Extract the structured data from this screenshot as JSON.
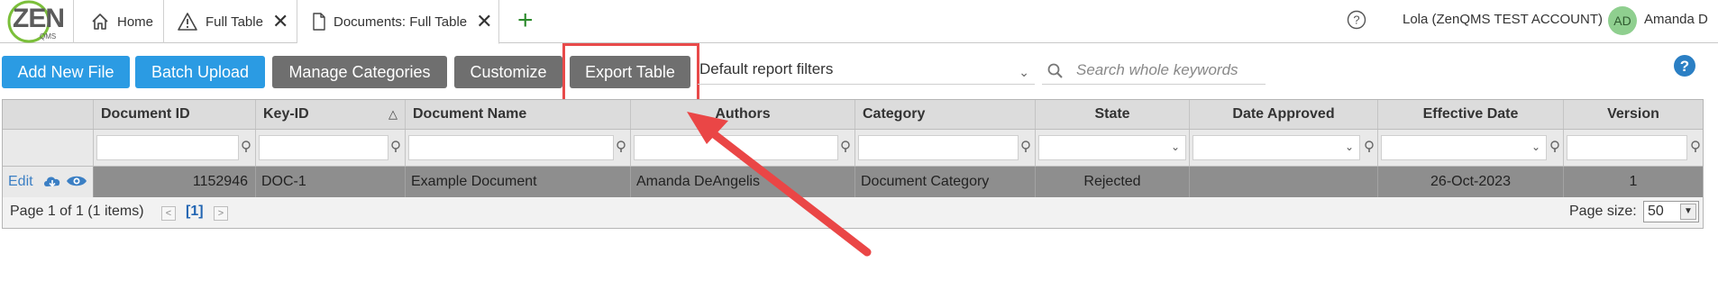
{
  "app": {
    "logo_text": "ZEN",
    "logo_sub": "QMS"
  },
  "tabs": [
    {
      "label": "Home",
      "icon": "home-icon",
      "closable": false
    },
    {
      "label": "Full Table",
      "icon": "warning-icon",
      "closable": true
    },
    {
      "label": "Documents: Full Table",
      "icon": "document-icon",
      "closable": true,
      "active": true
    }
  ],
  "topbar": {
    "add_tab": "+",
    "close_glyph": "✕",
    "help_icon": "question-circle-icon",
    "account": "Lola (ZenQMS TEST ACCOUNT)",
    "avatar_initials": "AD",
    "avatar_color": "#8fcf8f",
    "user_name": "Amanda D"
  },
  "toolbar": {
    "add_new_file": "Add New File",
    "batch_upload": "Batch Upload",
    "manage_categories": "Manage Categories",
    "customize": "Customize",
    "export_table": "Export Table",
    "report_filter": "Default report filters",
    "search_placeholder": "Search whole keywords",
    "primary_color": "#2b9be3",
    "secondary_color": "#6f6f6f",
    "highlight_color": "#e84a4a"
  },
  "grid": {
    "columns": [
      "",
      "Document ID",
      "Key-ID",
      "Document Name",
      "Authors",
      "Category",
      "State",
      "Date Approved",
      "Effective Date",
      "Version"
    ],
    "sort_indicator": "△",
    "rows": [
      {
        "edit": "Edit",
        "document_id": "1152946",
        "key_id": "DOC-1",
        "document_name": "Example Document",
        "authors": "Amanda DeAngelis",
        "category": "Document Category",
        "state": "Rejected",
        "date_approved": "",
        "effective_date": "26-Oct-2023",
        "version": "1"
      }
    ],
    "pager": {
      "info": "Page 1 of 1 (1 items)",
      "current_page": "[1]",
      "prev": "<",
      "next": ">",
      "page_size_label": "Page size:",
      "page_size": "50"
    }
  }
}
